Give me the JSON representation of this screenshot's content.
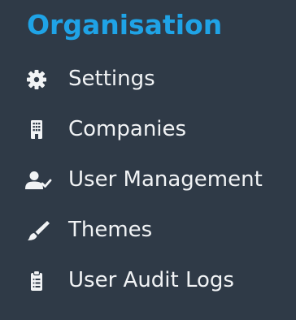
{
  "sidebar": {
    "section_title": "Organisation",
    "accent_color": "#1fa3e6",
    "items": [
      {
        "label": "Settings",
        "icon": "gear-icon"
      },
      {
        "label": "Companies",
        "icon": "building-icon"
      },
      {
        "label": "User Management",
        "icon": "user-check-icon"
      },
      {
        "label": "Themes",
        "icon": "paint-brush-icon"
      },
      {
        "label": "User Audit Logs",
        "icon": "clipboard-list-icon"
      }
    ]
  }
}
